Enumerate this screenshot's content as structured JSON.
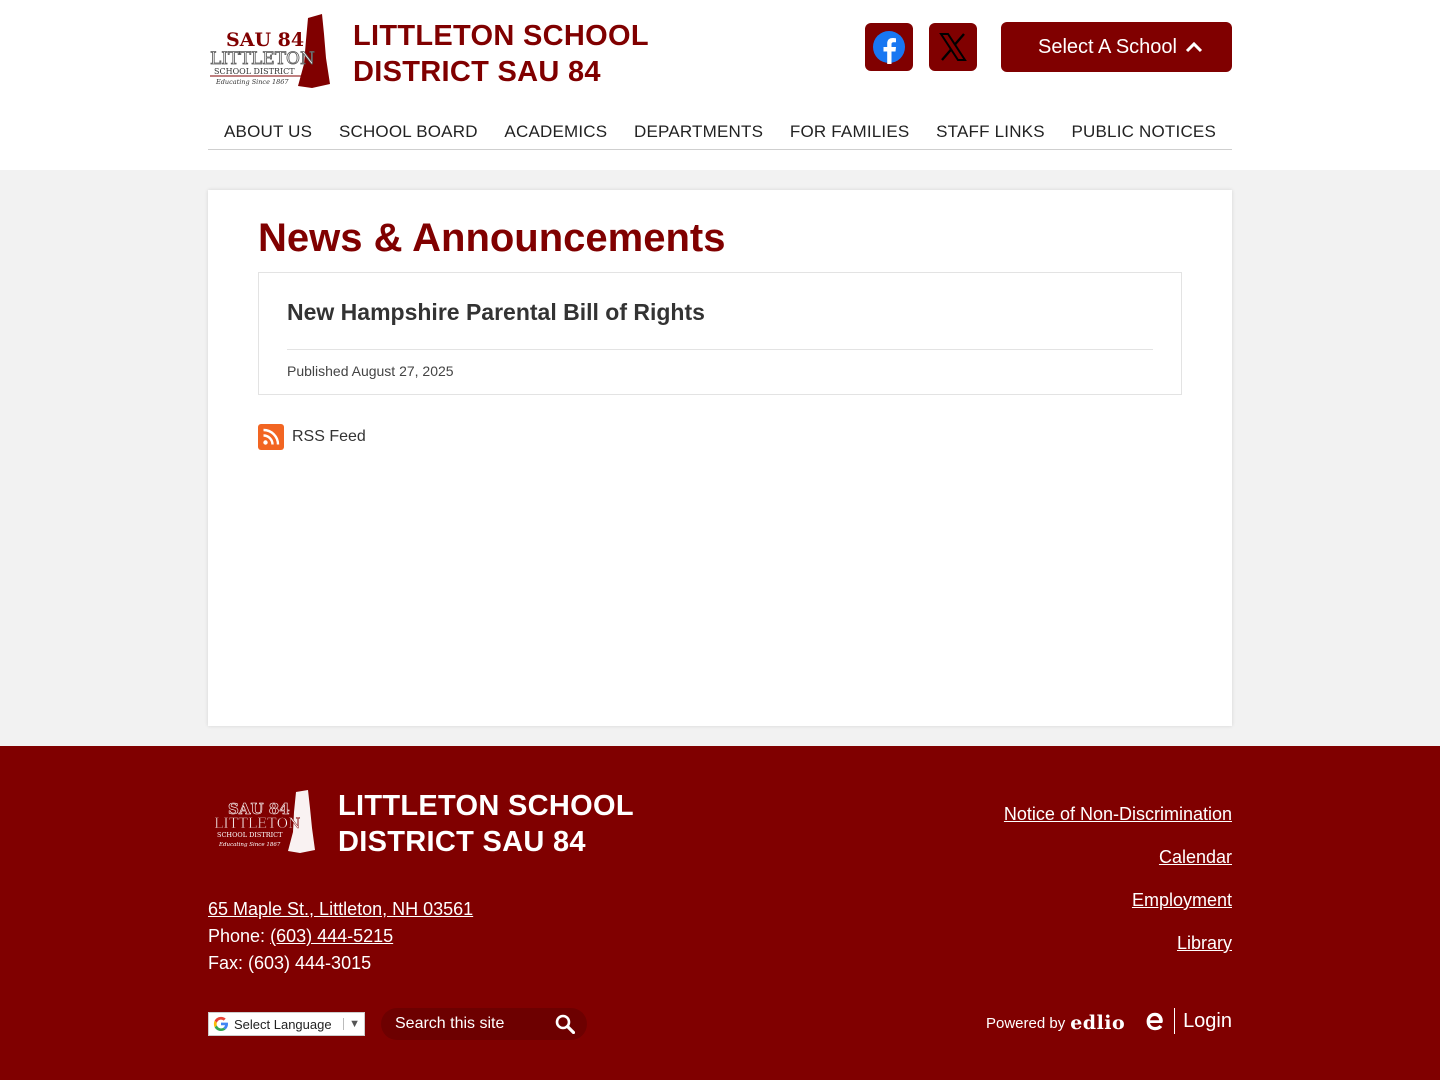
{
  "header": {
    "logo_text": [
      "SAU 84",
      "LITTLETON",
      "SCHOOL DISTRICT",
      "Educating Since 1867"
    ],
    "site_title_line1": "LITTLETON SCHOOL",
    "site_title_line2": "DISTRICT SAU 84",
    "social": [
      {
        "name": "facebook",
        "icon": "facebook-icon"
      },
      {
        "name": "x",
        "icon": "x-icon"
      }
    ],
    "school_select_label": "Select A School"
  },
  "nav": {
    "items": [
      "ABOUT US",
      "SCHOOL BOARD",
      "ACADEMICS",
      "DEPARTMENTS",
      "FOR FAMILIES",
      "STAFF LINKS",
      "PUBLIC NOTICES"
    ]
  },
  "main": {
    "heading": "News & Announcements",
    "news": [
      {
        "title": "New Hampshire Parental Bill of Rights",
        "date": "Published August 27, 2025"
      }
    ],
    "rss_label": "RSS Feed"
  },
  "footer": {
    "title_line1": "LITTLETON SCHOOL",
    "title_line2": "DISTRICT SAU 84",
    "address": "65 Maple St., Littleton, NH 03561",
    "phone_label": "Phone:",
    "phone": "(603) 444-5215",
    "fax": "Fax: (603) 444-3015",
    "links": [
      "Notice of Non-Discrimination",
      "Calendar",
      "Employment",
      "Library"
    ],
    "translate_label": "Select Language",
    "translate_arrow": "▼",
    "search_placeholder": "Search this site",
    "powered_by": "Powered by",
    "powered_brand": "edlio",
    "login_label": "Login"
  },
  "colors": {
    "brand": "#800000",
    "background": "#f2f2f2",
    "rss": "#f26522"
  }
}
